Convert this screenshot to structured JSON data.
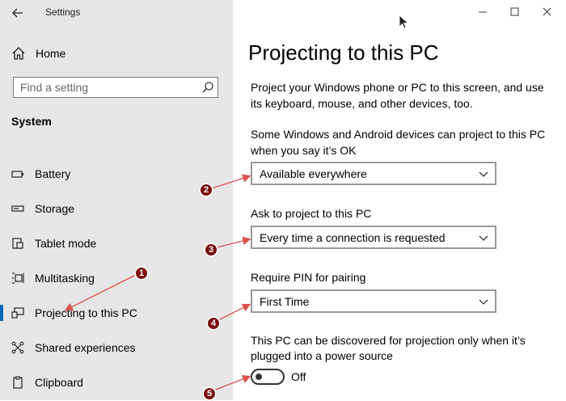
{
  "window": {
    "title": "Settings",
    "controls": {
      "minimize": "minimize-icon",
      "maximize": "maximize-icon",
      "close": "close-icon"
    }
  },
  "sidebar": {
    "home_label": "Home",
    "search_placeholder": "Find a setting",
    "section_title": "System",
    "items": [
      {
        "label": "Battery",
        "icon": "battery-icon"
      },
      {
        "label": "Storage",
        "icon": "storage-icon"
      },
      {
        "label": "Tablet mode",
        "icon": "tablet-mode-icon"
      },
      {
        "label": "Multitasking",
        "icon": "multitasking-icon"
      },
      {
        "label": "Projecting to this PC",
        "icon": "projecting-icon",
        "active": true
      },
      {
        "label": "Shared experiences",
        "icon": "shared-experiences-icon"
      },
      {
        "label": "Clipboard",
        "icon": "clipboard-icon"
      }
    ]
  },
  "main": {
    "title": "Projecting to this PC",
    "intro": "Project your Windows phone or PC to this screen, and use its keyboard, mouse, and other devices, too.",
    "setting1_label_line1": "Some Windows and Android devices can project to this PC",
    "setting1_label_line2": "when you say it’s OK",
    "setting1_value": "Available everywhere",
    "setting2_label": "Ask to project to this PC",
    "setting2_value": "Every time a connection is requested",
    "setting3_label": "Require PIN for pairing",
    "setting3_value": "First Time",
    "setting4_label_line1": "This PC can be discovered for projection only when it’s",
    "setting4_label_line2": "plugged into a power source",
    "setting4_state": "Off"
  },
  "annotations": {
    "badges": [
      "1",
      "2",
      "3",
      "4",
      "5"
    ],
    "color": "#7a0d0d"
  },
  "colors": {
    "sidebar_bg": "#e6e6e6",
    "accent": "#0067b8",
    "annotation_line": "#d9534f"
  }
}
